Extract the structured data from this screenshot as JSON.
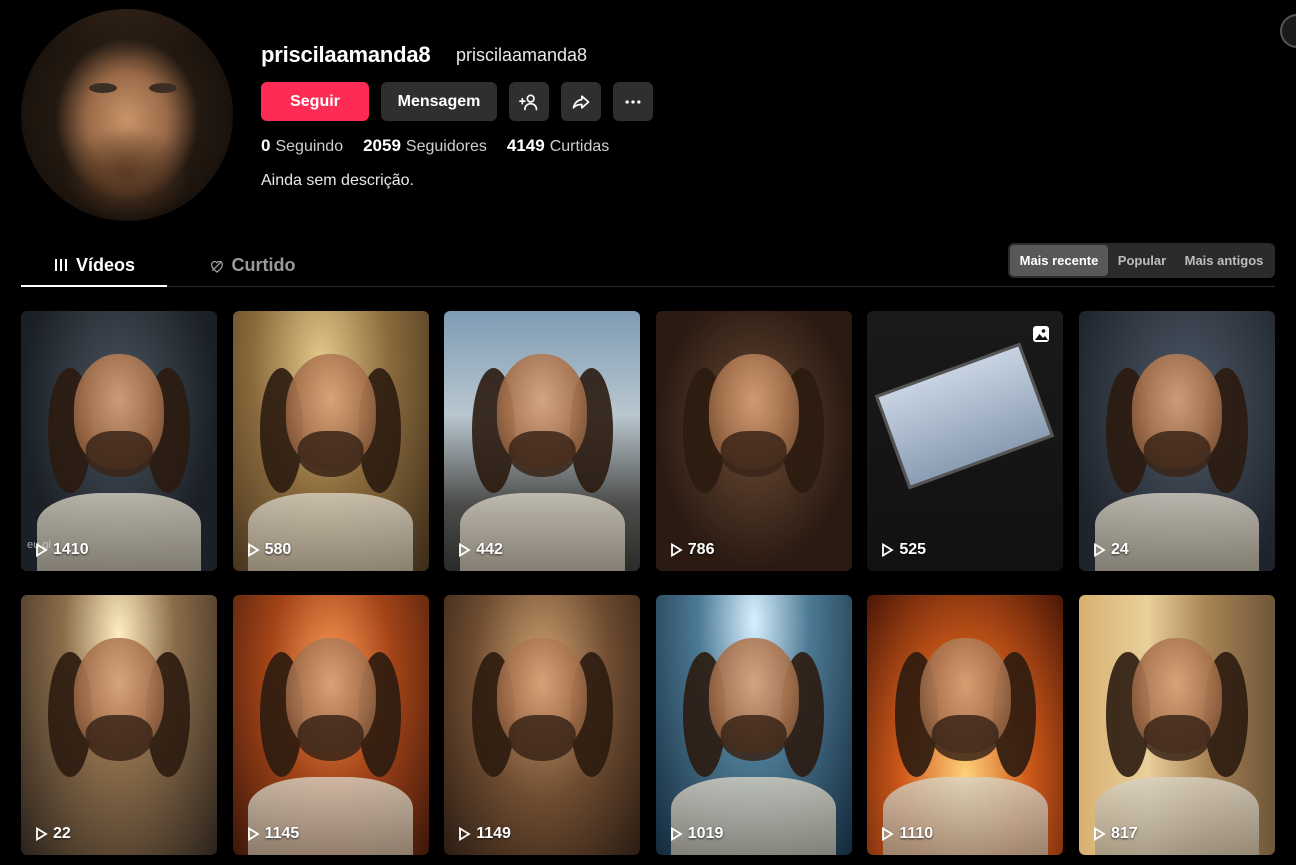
{
  "profile": {
    "username": "priscilaamanda8",
    "nickname": "priscilaamanda8",
    "bio": "Ainda sem descrição.",
    "stats": [
      {
        "value": "0",
        "label": "Seguindo"
      },
      {
        "value": "2059",
        "label": "Seguidores"
      },
      {
        "value": "4149",
        "label": "Curtidas"
      }
    ]
  },
  "actions": {
    "follow_label": "Seguir",
    "message_label": "Mensagem",
    "add_friend_icon": "add-friend-icon",
    "share_icon": "share-icon",
    "more_icon": "more-icon"
  },
  "tabs": {
    "videos_label": "Vídeos",
    "liked_label": "Curtido"
  },
  "sort": {
    "options": [
      "Mais recente",
      "Popular",
      "Mais antigos"
    ],
    "selected": "Mais recente"
  },
  "videos": [
    {
      "views": "1410",
      "watermark": "eu gi"
    },
    {
      "views": "580"
    },
    {
      "views": "442"
    },
    {
      "views": "786"
    },
    {
      "views": "525",
      "type": "photo"
    },
    {
      "views": "24"
    },
    {
      "views": "22"
    },
    {
      "views": "1145"
    },
    {
      "views": "1149"
    },
    {
      "views": "1019"
    },
    {
      "views": "1110"
    },
    {
      "views": "817"
    }
  ],
  "colors": {
    "accent": "#fe2c55",
    "background": "#000000",
    "button_secondary": "#2f2f2f"
  }
}
